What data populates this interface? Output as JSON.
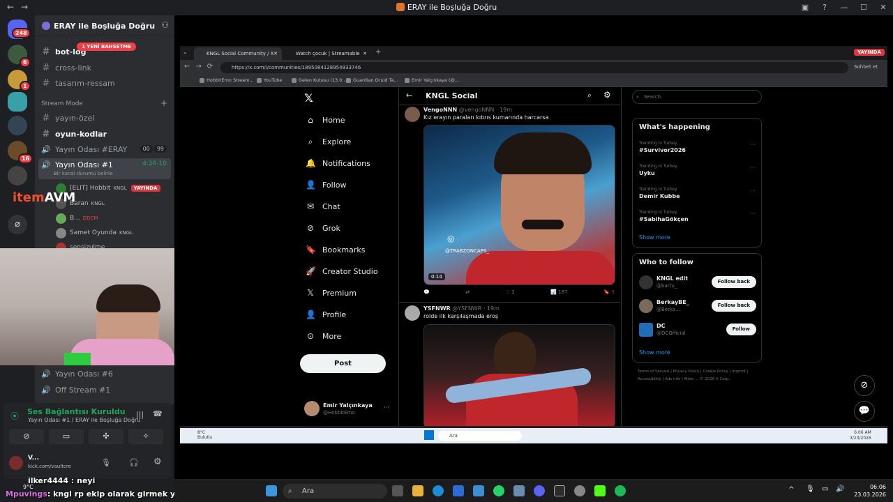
{
  "window": {
    "title": "ERAY ile Boşluğa Doğru"
  },
  "rail": {
    "mentions_badge": "248",
    "badge_6": "6",
    "badge_1": "1",
    "badge_16": "16"
  },
  "server": {
    "name": "ERAY ile Boşluğa Doğru"
  },
  "sidebar": {
    "new_mention": "1 YENİ BAHSETME",
    "channels_top": [
      {
        "label": "bot-log"
      },
      {
        "label": "cross-link"
      },
      {
        "label": "tasarım-ressam"
      }
    ],
    "category": "Stream Mode",
    "channels": [
      {
        "label": "yayın-özel"
      },
      {
        "label": "oyun-kodlar"
      }
    ],
    "voice_eray": {
      "label": "Yayın Odası #ERAY",
      "pill1": "00",
      "pill2": "99"
    },
    "voice_1": {
      "label": "Yayın Odası #1",
      "timer": "4:26:10",
      "status": "Bir kanal durumu belirle"
    },
    "users": [
      {
        "name": "[ELIT] Hobbit",
        "tag": "KNGL",
        "live": "YAYINDA"
      },
      {
        "name": "Baran",
        "tag": "KNGL"
      },
      {
        "name": "B...",
        "tag": "DDCM"
      },
      {
        "name": "Samet Oyunda",
        "tag": "KNGL"
      },
      {
        "name": "sensizulme"
      }
    ],
    "voice_6": "Yayın Odası #6",
    "off_stream": "Off Stream #1"
  },
  "voice_panel": {
    "status": "Ses Bağlantısı Kuruldu",
    "location": "Yayın Odası #1 / ERAY ile Boşluğa Doğru",
    "user_name": "V...",
    "user_status": "kick.com/vaultcre"
  },
  "logo": {
    "item": "item",
    "avm": "AVM"
  },
  "browser": {
    "tabs": [
      {
        "label": "KNGL Social Community / X"
      },
      {
        "label": "Watch çocuk | Streamable"
      }
    ],
    "live_badge": "YAYINDA",
    "url": "https://x.com/i/communities/1895084128954933746",
    "sohbet": "Sohbet et",
    "bookmarks": [
      "HobbitEmo Stream...",
      "YouTube",
      "Gelen Kutusu (13.0...",
      "Guardian Druid Ta...",
      "Emir Yalçınkaya (@..."
    ]
  },
  "x": {
    "nav": [
      "Home",
      "Explore",
      "Notifications",
      "Follow",
      "Chat",
      "Grok",
      "Bookmarks",
      "Creator Studio",
      "Premium",
      "Profile",
      "More"
    ],
    "post": "Post",
    "account": {
      "name": "Emir Yalçınkaya",
      "handle": "@HobbitEmo"
    },
    "community_title": "KNGL Social",
    "tweet1": {
      "name": "VengoNNN",
      "handle": "@vengoNNN",
      "time": "19m",
      "text": "Kız erayın paraları kıbrıs kumarında harcarsa",
      "watermark": "@TRABZONCAPS_",
      "duration": "0:14",
      "likes": "2",
      "views": "187"
    },
    "tweet2": {
      "name": "YSFNWR",
      "handle": "@YSFNWR",
      "time": "19m",
      "text": "rolde ilk karşılaşmada eroş"
    },
    "search_placeholder": "Search",
    "happening": {
      "title": "What's happening",
      "trends": [
        {
          "context": "Trending in Turkey",
          "name": "#Survivor2026"
        },
        {
          "context": "Trending in Turkey",
          "name": "Uyku"
        },
        {
          "context": "Trending in Turkey",
          "name": "Demir Kubbe"
        },
        {
          "context": "Trending in Turkey",
          "name": "#SabihaGökçen"
        }
      ],
      "show_more": "Show more"
    },
    "who_to_follow": {
      "title": "Who to follow",
      "accounts": [
        {
          "name": "KNGL edit",
          "handle": "@bartu_",
          "button": "Follow back"
        },
        {
          "name": "BerkayBE_",
          "handle": "@Berka...",
          "button": "Follow back"
        },
        {
          "name": "DC",
          "handle": "@DCOfficial",
          "button": "Follow"
        }
      ],
      "show_more": "Show more"
    },
    "footer": "Terms of Service | Privacy Policy | Cookie Policy | Imprint | Accessibility | Ads info | More ... © 2026 X Corp."
  },
  "inner_taskbar": {
    "weather": "8°C",
    "weather_sub": "Bulutlu",
    "search": "Ara",
    "time": "6:06 AM",
    "date": "3/23/2026"
  },
  "chat": {
    "line1": "ilker4444 : neyi",
    "line2_user": "Mpuvings",
    "line2_text": ": kngl rp ekip olarak girmek yasak değil miydi?"
  },
  "taskbar": {
    "weather": "9°C",
    "search": "Ara",
    "time": "06:06",
    "date": "23.03.2026"
  }
}
